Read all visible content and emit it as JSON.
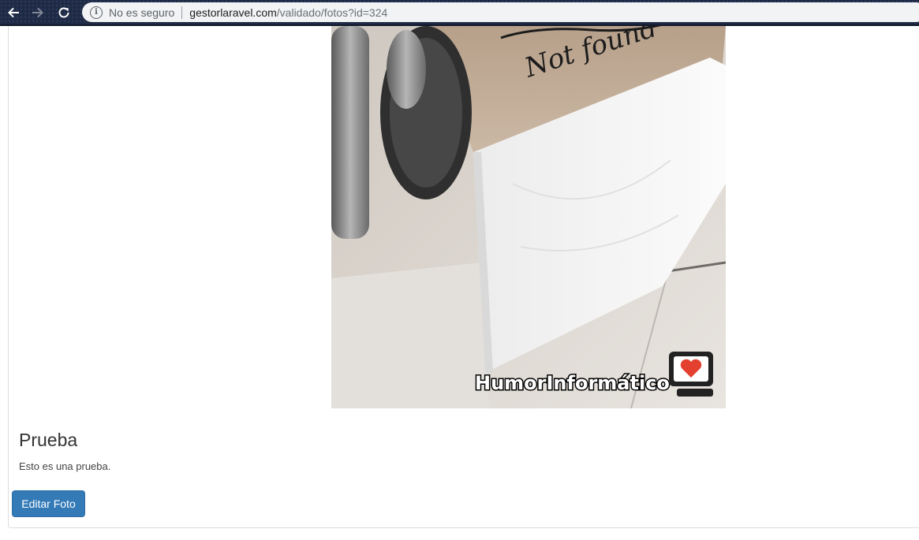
{
  "browser": {
    "security_label": "No es seguro",
    "url_host": "gestorlaravel.com",
    "url_path": "/validado/fotos?id=324"
  },
  "photo": {
    "handwritten_text": "Not found",
    "watermark": "HumorInformático"
  },
  "content": {
    "title": "Prueba",
    "description": "Esto es una prueba.",
    "edit_button_label": "Editar Foto"
  },
  "colors": {
    "button": "#337ab7",
    "toolbar": "#1f2a44"
  }
}
